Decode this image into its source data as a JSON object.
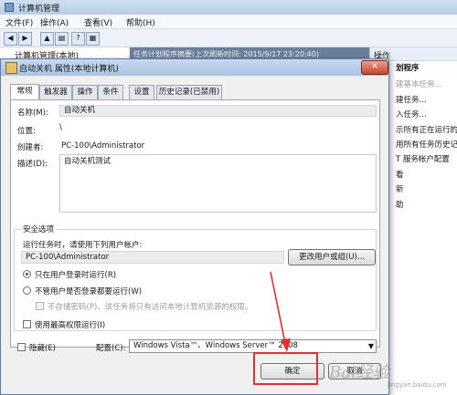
{
  "main_window": {
    "title": "计算机管理",
    "menu": [
      "文件(F)",
      "操作(A)",
      "查看(V)",
      "帮助(H)"
    ],
    "tree_root": "计算机管理(本地)",
    "banner": "任务计划程序摘要(上次刷新时间: 2015/9/17 23:20:40)",
    "actions_header": "操作",
    "actions": [
      {
        "label": "划程序",
        "style": "bold"
      },
      {
        "label": "建基本任务...",
        "style": "disabled"
      },
      {
        "label": "建任务...",
        "style": "normal"
      },
      {
        "label": "入任务...",
        "style": "normal"
      },
      {
        "label": "示所有正在运行的",
        "style": "normal"
      },
      {
        "label": "用所有任务历史记",
        "style": "normal"
      },
      {
        "label": "T 服务帐户配置",
        "style": "normal"
      },
      {
        "label": "看",
        "style": "normal"
      },
      {
        "label": "新",
        "style": "normal"
      },
      {
        "label": "助",
        "style": "normal"
      }
    ]
  },
  "dialog": {
    "title": "自动关机 属性(本地计算机)",
    "close_label": "✕",
    "tabs": [
      {
        "label": "常规",
        "active": true
      },
      {
        "label": "触发器",
        "active": false
      },
      {
        "label": "操作",
        "active": false
      },
      {
        "label": "条件",
        "active": false
      },
      {
        "label": "设置",
        "active": false
      },
      {
        "label": "历史记录(已禁用)",
        "active": false
      }
    ],
    "general": {
      "name_label": "名称(M):",
      "name_value": "自动关机",
      "location_label": "位置:",
      "location_value": "\\",
      "author_label": "创建者:",
      "author_value": "PC-100\\Administrator",
      "description_label": "描述(D):",
      "description_value": "自动关机测试"
    },
    "security": {
      "group_label": "安全选项",
      "run_as_prompt": "运行任务时，请使用下列用户帐户:",
      "user_account": "PC-100\\Administrator",
      "change_user_button": "更改用户或组(U)...",
      "radio_logged_on": "只在用户登录时运行(R)",
      "radio_whether_logged": "不管用户是否登录都要运行(W)",
      "no_store_password": "不存储密码(P)。该任务将只有访问本地计算机资源的权限。",
      "highest_privileges": "使用最高权限运行(I)",
      "selected_radio": "logged_on"
    },
    "hidden_label": "隐藏(E)",
    "configure_label": "配置(C):",
    "configure_value": "Windows Vista™、Windows Server™ 2008",
    "ok_button": "确定",
    "cancel_button": "取消"
  },
  "watermark": {
    "brand": "Bai经验",
    "url": "jingyan.baidu.com"
  },
  "colors": {
    "annotation": "#e03030",
    "title_bar": "#b7cde6",
    "banner": "#6b7f99"
  }
}
